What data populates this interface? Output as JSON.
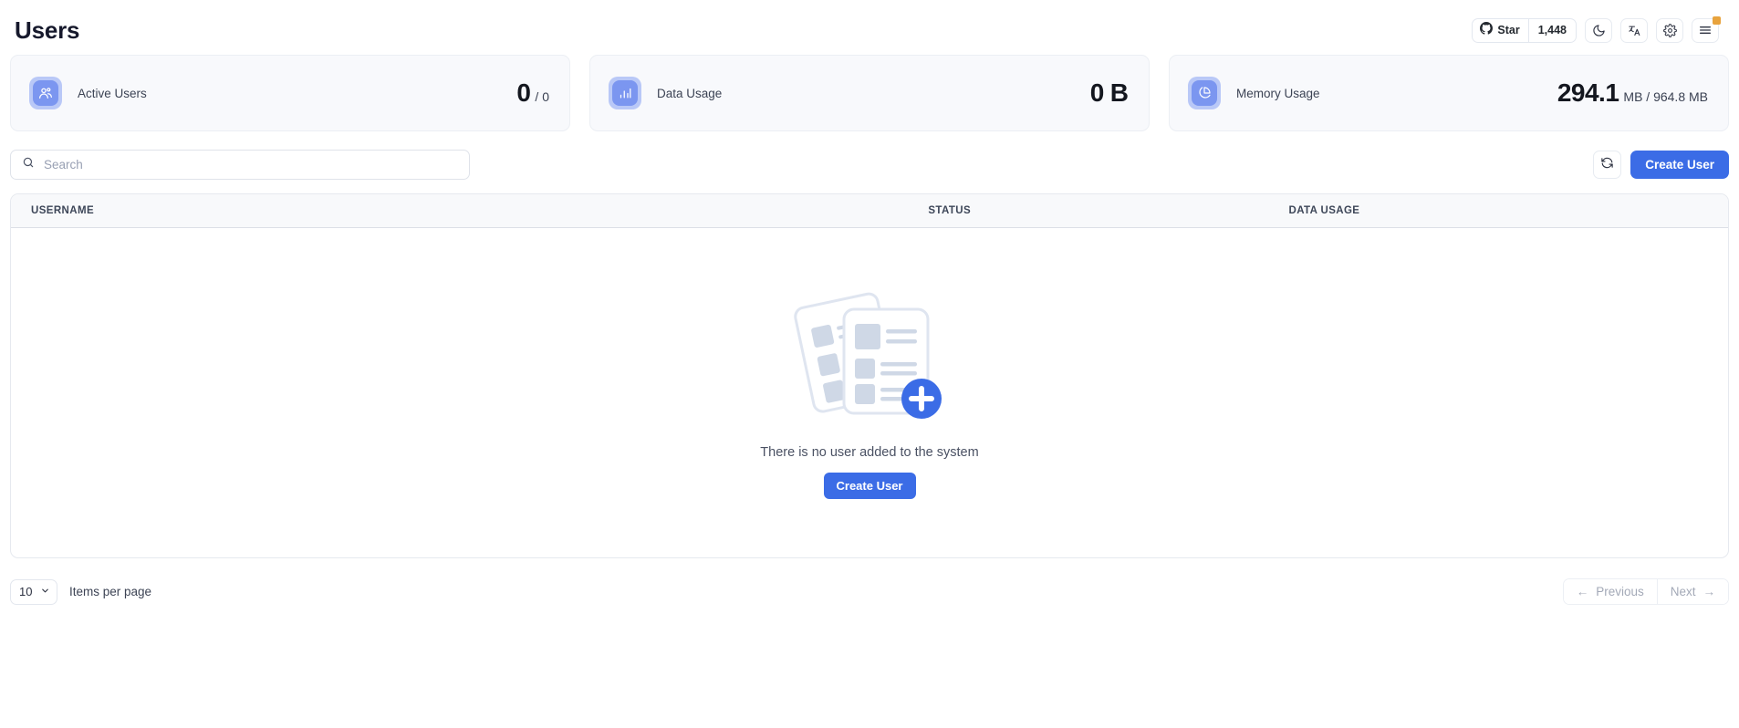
{
  "header": {
    "title": "Users",
    "github": {
      "label": "Star",
      "count": "1,448",
      "icon": "github-icon"
    },
    "actions": [
      {
        "name": "dark-mode-toggle",
        "icon": "moon-icon"
      },
      {
        "name": "language-switcher",
        "icon": "translate-icon"
      },
      {
        "name": "settings-button",
        "icon": "gear-icon"
      },
      {
        "name": "menu-button",
        "icon": "hamburger-icon",
        "badge": true
      }
    ]
  },
  "stats": [
    {
      "id": "active-users",
      "icon": "users-icon",
      "label": "Active Users",
      "value": "0",
      "suffix": "/ 0"
    },
    {
      "id": "data-usage",
      "icon": "bar-chart-icon",
      "label": "Data Usage",
      "value": "0",
      "unit": "B"
    },
    {
      "id": "memory-usage",
      "icon": "pie-chart-icon",
      "label": "Memory Usage",
      "value": "294.1",
      "suffix": "MB / 964.8 MB"
    }
  ],
  "toolbar": {
    "search_placeholder": "Search",
    "search_value": "",
    "refresh_icon": "refresh-icon",
    "create_user_label": "Create User"
  },
  "table": {
    "columns": [
      "USERNAME",
      "STATUS",
      "DATA USAGE"
    ],
    "rows": [],
    "empty": {
      "message": "There is no user added to the system",
      "action_label": "Create User",
      "illustration": "empty-documents-with-plus"
    }
  },
  "footer": {
    "items_per_page_value": "10",
    "items_per_page_label": "Items per page",
    "previous_label": "Previous",
    "next_label": "Next",
    "previous_arrow": "←",
    "next_arrow": "→"
  },
  "colors": {
    "accent": "#3b6ce6",
    "icon_tile": "#7b96f0",
    "icon_ring": "#b9c8f7",
    "card_bg": "#f8f9fc",
    "badge": "#e8a33d",
    "muted_text": "#a3a9b7"
  }
}
